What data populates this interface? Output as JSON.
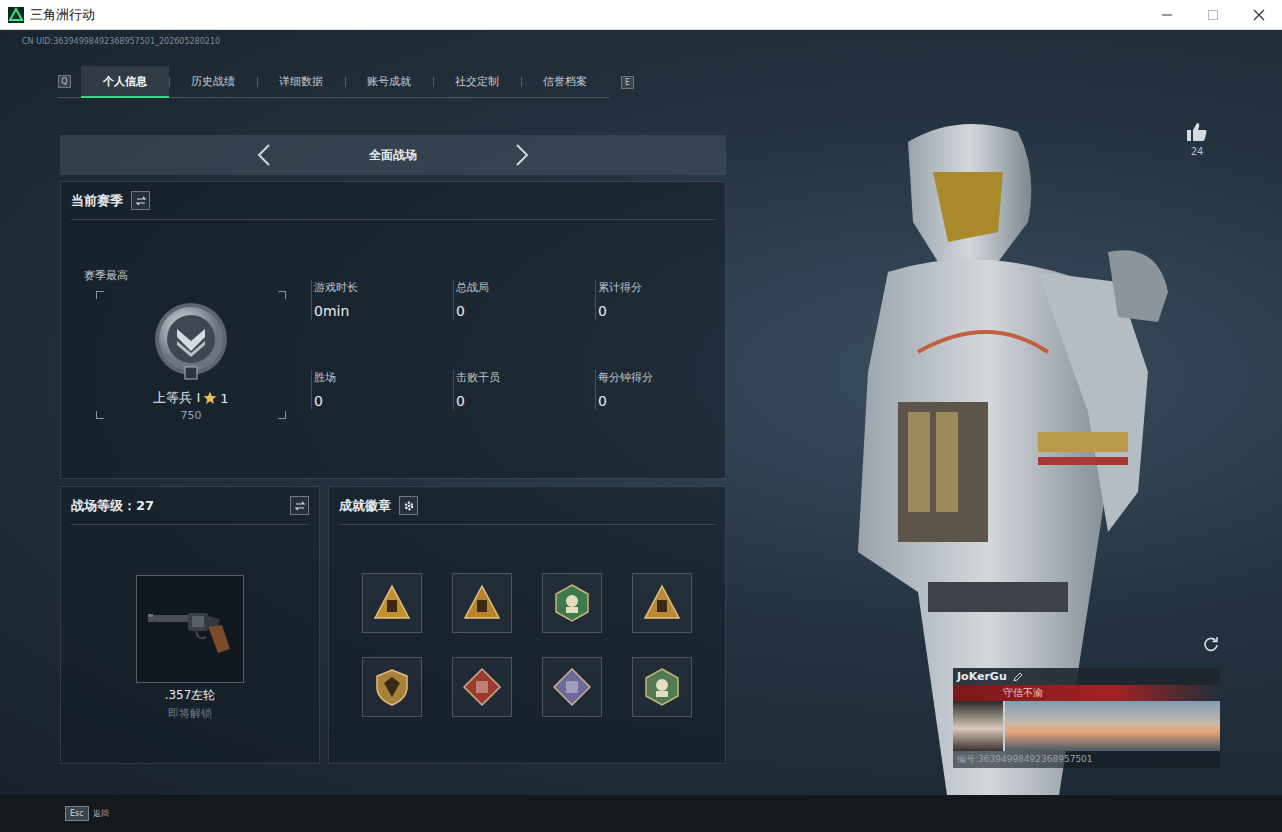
{
  "window": {
    "title": "三角洲行动"
  },
  "uid": "CN UID:36394998492368957501_202605280210",
  "tabs": {
    "prev_key": "Q",
    "next_key": "E",
    "items": [
      {
        "label": "个人信息",
        "selected": true
      },
      {
        "label": "历史战绩",
        "selected": false
      },
      {
        "label": "详细数据",
        "selected": false
      },
      {
        "label": "账号成就",
        "selected": false
      },
      {
        "label": "社交定制",
        "selected": false
      },
      {
        "label": "信誉档案",
        "selected": false
      }
    ]
  },
  "mode": {
    "label": "全面战场"
  },
  "season": {
    "title": "当前赛季",
    "best_label": "赛季最高",
    "rank": "上等兵 Ⅰ",
    "star_count": "1",
    "score": "750",
    "stats": [
      {
        "label": "游戏时长",
        "value": "0min"
      },
      {
        "label": "总战局",
        "value": "0"
      },
      {
        "label": "累计得分",
        "value": "0"
      },
      {
        "label": "胜场",
        "value": "0"
      },
      {
        "label": "击败干员",
        "value": "0"
      },
      {
        "label": "每分钟得分",
        "value": "0"
      }
    ]
  },
  "level": {
    "title": "战场等级：27",
    "weapon": ".357左轮",
    "status": "即将解锁"
  },
  "badges": {
    "title": "成就徽章",
    "items": [
      {
        "kind": "triangle",
        "color": "#c0902f"
      },
      {
        "kind": "triangle",
        "color": "#b9822c"
      },
      {
        "kind": "hexagon",
        "color": "#3f7a4e"
      },
      {
        "kind": "triangle",
        "color": "#b78a3a"
      },
      {
        "kind": "shield",
        "color": "#a8823c"
      },
      {
        "kind": "diamond",
        "color": "#9a3b2c"
      },
      {
        "kind": "diamond",
        "color": "#6d6a9a"
      },
      {
        "kind": "hexagon",
        "color": "#4f7a54"
      }
    ]
  },
  "likes": "24",
  "player": {
    "name": "JoKerGu",
    "motto": "守信不渝",
    "id": "编号:36394998492368957501"
  },
  "footer": {
    "key": "Esc",
    "label": "返回"
  }
}
